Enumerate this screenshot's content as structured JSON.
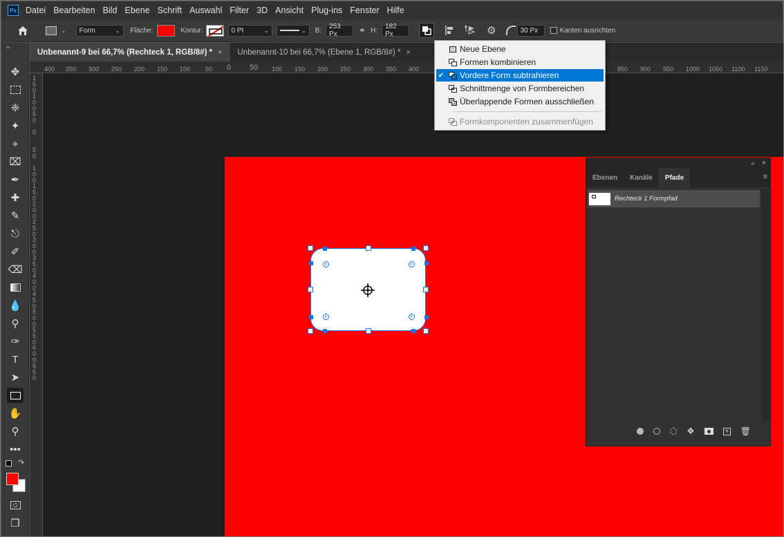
{
  "app": {
    "logo": "Ps"
  },
  "menu": [
    "Datei",
    "Bearbeiten",
    "Bild",
    "Ebene",
    "Schrift",
    "Auswahl",
    "Filter",
    "3D",
    "Ansicht",
    "Plug-ins",
    "Fenster",
    "Hilfe"
  ],
  "options": {
    "mode": "Form",
    "fill_label": "Fläche:",
    "fill_color": "#ff0000",
    "stroke_label": "Kontur:",
    "stroke_width": "0 Pt",
    "w_label": "B:",
    "w_value": "253 Px",
    "h_label": "H:",
    "h_value": "182 Px",
    "radius_value": "30 Px",
    "align_edges_label": "Kanten ausrichten"
  },
  "tabs": [
    {
      "label": "Unbenannt-9 bei 66,7% (Rechteck 1, RGB/8#) *",
      "active": true
    },
    {
      "label": "Unbenannt-10 bei 66,7% (Ebene 1, RGB/8#) *",
      "active": false
    }
  ],
  "ruler": {
    "h_ticks": [
      "400",
      "350",
      "300",
      "250",
      "200",
      "150",
      "100",
      "50",
      "0",
      "50",
      "100",
      "150",
      "200",
      "250",
      "300",
      "350",
      "400",
      "850",
      "900",
      "950",
      "1000",
      "1050",
      "1100",
      "1150"
    ],
    "v_ticks": [
      "1\n5\n0",
      "1\n0\n0",
      "5\n0",
      "0",
      "5\n0",
      "1\n0\n0",
      "1\n5\n0",
      "2\n0\n0",
      "2\n5\n0",
      "3\n0\n0",
      "3\n5\n0",
      "4\n0\n0",
      "4\n5\n0",
      "5\n0\n0",
      "5\n5\n0",
      "6\n0\n0",
      "6\n5\n0"
    ]
  },
  "dropdown": {
    "items": [
      {
        "label": "Neue Ebene",
        "checked": false,
        "highlighted": false,
        "disabled": false
      },
      {
        "label": "Formen kombinieren",
        "checked": false,
        "highlighted": false,
        "disabled": false
      },
      {
        "label": "Vordere Form subtrahieren",
        "checked": true,
        "highlighted": true,
        "disabled": false
      },
      {
        "label": "Schnittmenge von Formbereichen",
        "checked": false,
        "highlighted": false,
        "disabled": false
      },
      {
        "label": "Überlappende Formen ausschließen",
        "checked": false,
        "highlighted": false,
        "disabled": false
      },
      {
        "label": "Formkomponenten zusammenfügen",
        "checked": false,
        "highlighted": false,
        "disabled": true
      }
    ]
  },
  "panel": {
    "tabs": [
      "Ebenen",
      "Kanäle",
      "Pfade"
    ],
    "active_tab": "Pfade",
    "paths": [
      {
        "name": "Rechteck 1 Formpfad"
      }
    ]
  },
  "colors": {
    "foreground": "#ff0000",
    "background": "#ffffff",
    "document": "#ff0000",
    "accent": "#1473e6"
  }
}
